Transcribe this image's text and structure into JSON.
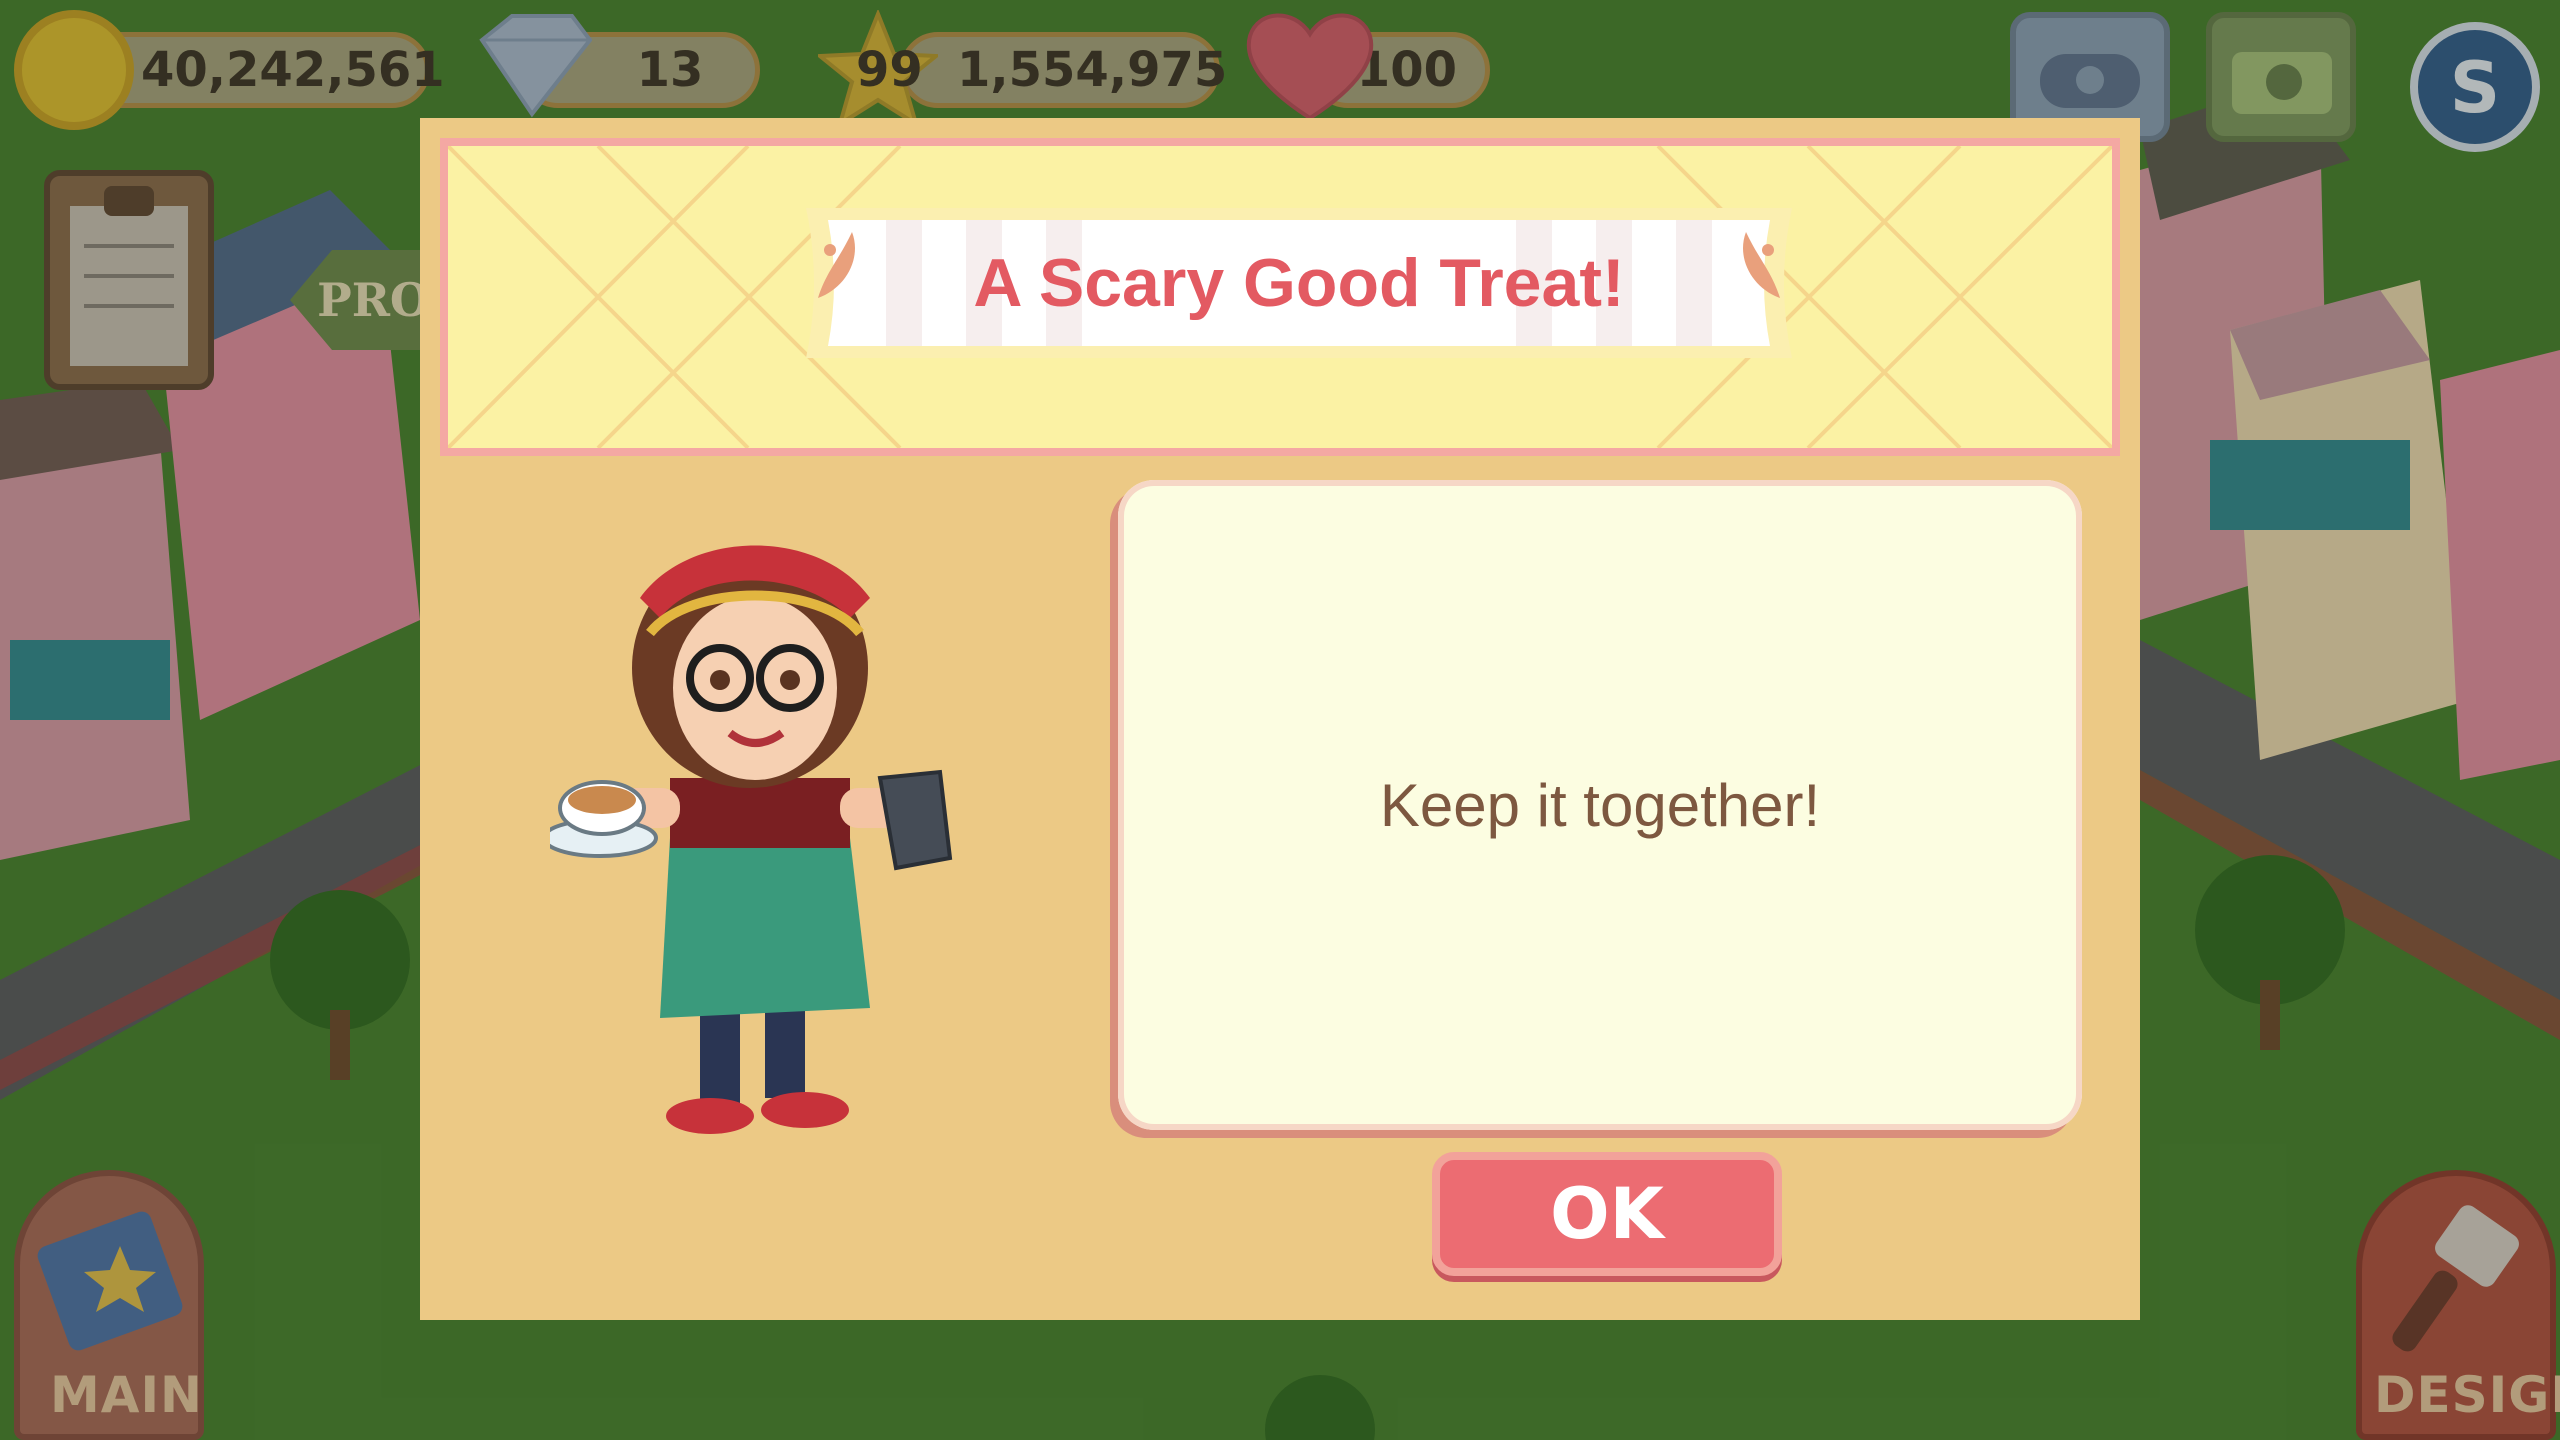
{
  "hud": {
    "coins": "40,242,561",
    "gems": "13",
    "level": "99",
    "xp": "1,554,975",
    "hearts": "100"
  },
  "background": {
    "promo_sign": "PRO"
  },
  "side_buttons": {
    "main_label": "MAIN",
    "design_label": "DESIGN"
  },
  "dialog": {
    "title": "A Scary Good Treat!",
    "message": "Keep it together!",
    "ok_label": "OK"
  },
  "colors": {
    "title": "#e35a62",
    "ok_button": "#ec6c72",
    "dialog_bg": "#ecc985",
    "message_bg": "#fcfde1"
  },
  "icons": [
    "coin-icon",
    "gem-icon",
    "star-icon",
    "heart-icon",
    "gamepad-icon",
    "camera-icon",
    "currency-icon",
    "clipboard-icon",
    "book-icon",
    "paintbrush-icon"
  ]
}
